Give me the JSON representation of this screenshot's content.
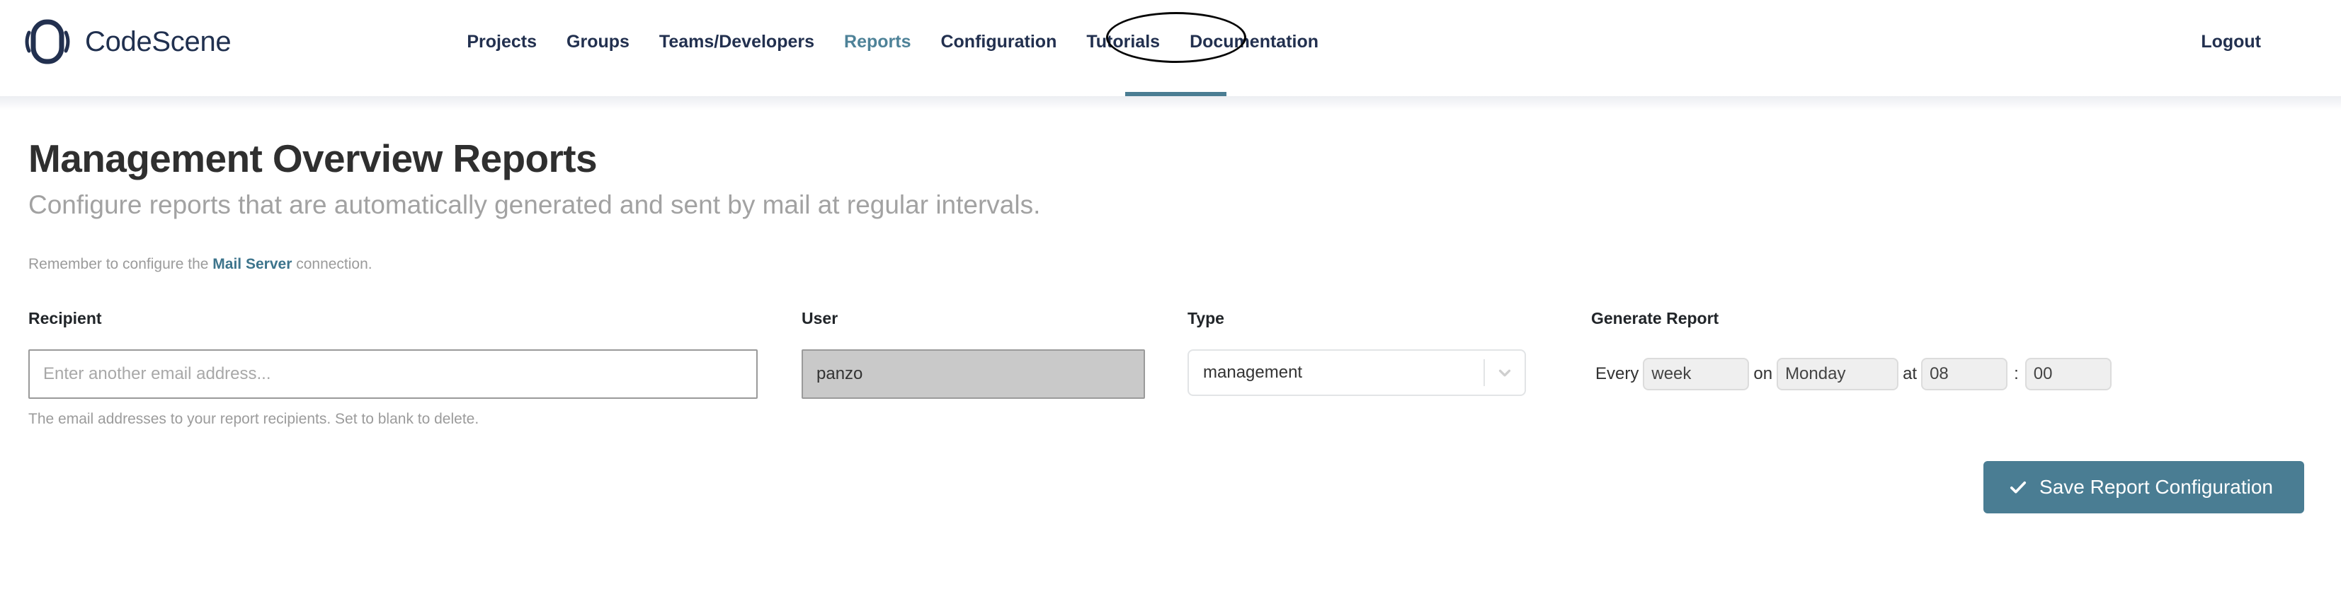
{
  "brand": {
    "name": "CodeScene",
    "logo_icon": "codescene-ring-logo"
  },
  "nav": {
    "items": [
      {
        "label": "Projects",
        "active": false
      },
      {
        "label": "Groups",
        "active": false
      },
      {
        "label": "Teams/Developers",
        "active": false
      },
      {
        "label": "Reports",
        "active": true
      },
      {
        "label": "Configuration",
        "active": false
      },
      {
        "label": "Tutorials",
        "active": false
      },
      {
        "label": "Documentation",
        "active": false
      }
    ],
    "logout_label": "Logout"
  },
  "page": {
    "title": "Management Overview Reports",
    "subtitle": "Configure reports that are automatically generated and sent by mail at regular intervals.",
    "hint_prefix": "Remember to configure the ",
    "hint_link": "Mail Server",
    "hint_suffix": " connection."
  },
  "form": {
    "recipient": {
      "label": "Recipient",
      "placeholder": "Enter another email address...",
      "value": "",
      "help": "The email addresses to your report recipients. Set to blank to delete."
    },
    "user": {
      "label": "User",
      "value": "panzo",
      "disabled": true
    },
    "type": {
      "label": "Type",
      "value": "management",
      "dropdown_icon": "chevron-down-icon"
    },
    "generate": {
      "label": "Generate Report",
      "every_label": "Every",
      "interval": "week",
      "on_label": "on",
      "day": "Monday",
      "at_label": "at",
      "hour": "08",
      "time_separator": ":",
      "minute": "00"
    }
  },
  "actions": {
    "save_label": "Save Report Configuration",
    "save_icon": "check-icon"
  },
  "colors": {
    "accent_teal": "#4a7d93",
    "brand_navy": "#22304f",
    "muted_text": "#9b9b9b",
    "disabled_bg": "#c9c9c9",
    "annotation": "#050505"
  }
}
